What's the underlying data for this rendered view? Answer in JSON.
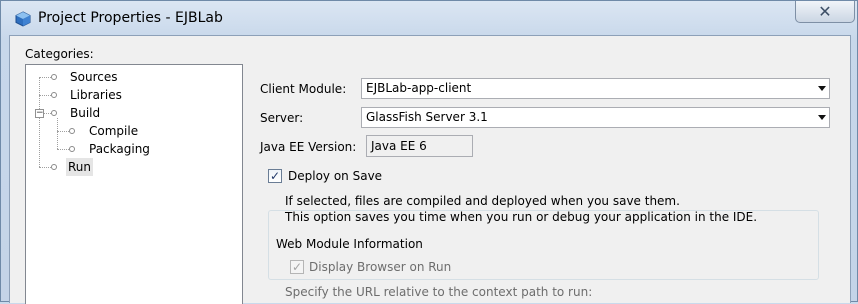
{
  "window": {
    "title": "Project Properties - EJBLab",
    "close_glyph": "✕"
  },
  "categories": {
    "label": "Categories:",
    "items": [
      {
        "label": "Sources"
      },
      {
        "label": "Libraries"
      },
      {
        "label": "Build",
        "expander": "−"
      },
      {
        "label": "Compile"
      },
      {
        "label": "Packaging"
      },
      {
        "label": "Run",
        "selected": true
      }
    ]
  },
  "form": {
    "client_module_label": "Client Module:",
    "client_module_value": "EJBLab-app-client",
    "server_label": "Server:",
    "server_value": "GlassFish Server 3.1",
    "javaee_label": "Java EE Version:",
    "javaee_value": "Java EE 6",
    "deploy_label": "Deploy on Save",
    "deploy_checked": true,
    "deploy_help_1": "If selected, files are compiled and deployed when you save them.",
    "deploy_help_2": "This option saves you time when you run or debug your application in the IDE.",
    "web_module_title": "Web Module Information",
    "display_browser_label": "Display Browser on Run",
    "display_browser_checked": true,
    "url_help": "Specify the URL relative to the context path to run:"
  },
  "icons": {
    "check_glyph": "✓"
  }
}
